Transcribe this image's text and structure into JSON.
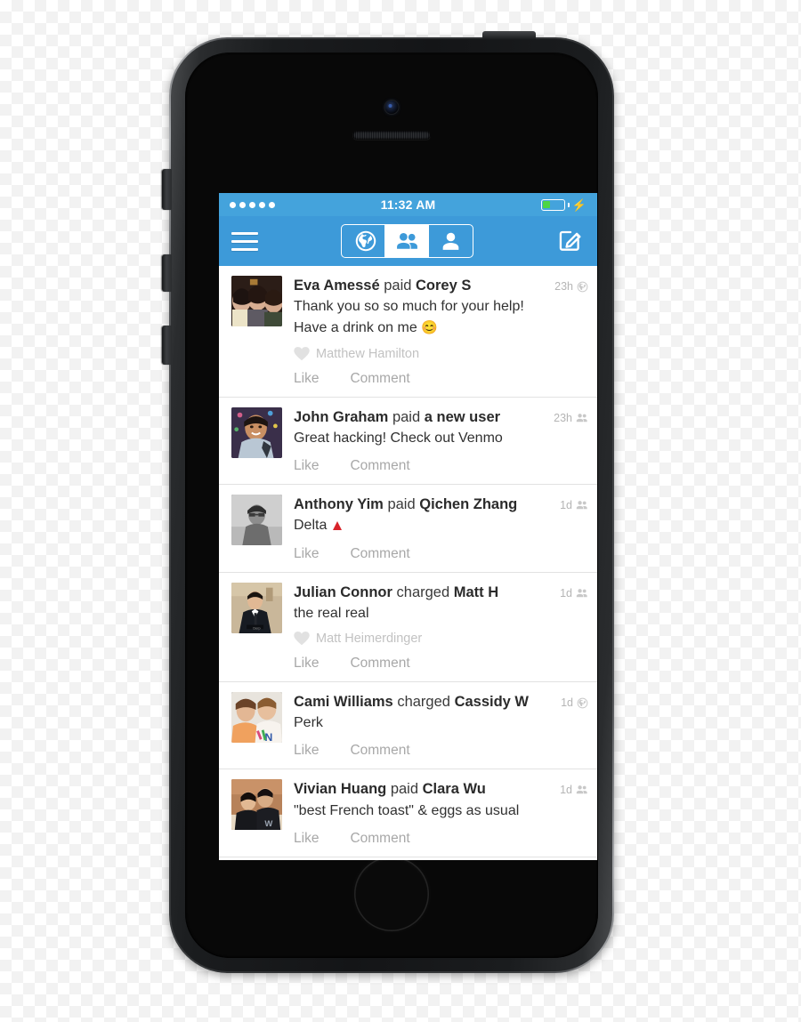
{
  "device": {
    "type": "smartphone-mockup",
    "model_style": "iphone-5s-space-gray",
    "buttons": {
      "mute_switch": "mute-switch",
      "volume_up": "volume-up-button",
      "volume_down": "volume-down-button",
      "power": "power-button",
      "home": "home-button"
    },
    "hardware_icons": {
      "camera": "front-camera",
      "speaker": "earpiece-speaker"
    }
  },
  "status_bar": {
    "signal_dots": 5,
    "time": "11:32 AM",
    "battery_percent": 35,
    "battery_color": "#4cd545",
    "charging": true,
    "charging_glyph": "⚡",
    "background": "#44a3dc"
  },
  "nav_bar": {
    "background": "#3d9ad9",
    "menu_label": "menu",
    "compose_label": "compose",
    "segments": [
      {
        "id": "public",
        "icon": "globe-icon",
        "label": "Public",
        "selected": false
      },
      {
        "id": "friends",
        "icon": "friends-icon",
        "label": "Friends",
        "selected": true
      },
      {
        "id": "mine",
        "icon": "person-icon",
        "label": "Mine",
        "selected": false
      }
    ]
  },
  "feed": {
    "actions": {
      "like": "Like",
      "comment": "Comment"
    },
    "items": [
      {
        "actor": "Eva Amessé",
        "verb": "paid",
        "target": "Corey S",
        "note": "Thank you so so much for your help!",
        "note2": "Have a drink on me",
        "emoji": "😊",
        "time": "23h",
        "audience": "globe-icon",
        "liker": "Matthew Hamilton",
        "avatar": "three-women-photo"
      },
      {
        "actor": "John Graham",
        "verb": "paid",
        "target": "a new user",
        "note": "Great hacking! Check out Venmo",
        "note2": "",
        "emoji": "",
        "time": "23h",
        "audience": "friends-icon",
        "liker": "",
        "avatar": "man-smiling-photo"
      },
      {
        "actor": "Anthony Yim",
        "verb": "paid",
        "target": "Qichen Zhang",
        "note": "Delta",
        "note2": "",
        "emoji": "",
        "time": "1d",
        "audience": "friends-icon",
        "liker": "",
        "avatar": "man-bw-photo",
        "trailing_glyph": "delta-triangle"
      },
      {
        "actor": "Julian Connor",
        "verb": "charged",
        "target": "Matt H",
        "note": "the real real",
        "note2": "",
        "emoji": "",
        "time": "1d",
        "audience": "friends-icon",
        "liker": "Matt Heimerdinger",
        "avatar": "man-suit-photo"
      },
      {
        "actor": "Cami Williams",
        "verb": "charged",
        "target": "Cassidy W",
        "note": "Perk",
        "note2": "",
        "emoji": "",
        "time": "1d",
        "audience": "globe-icon",
        "liker": "",
        "avatar": "two-women-photo"
      },
      {
        "actor": "Vivian Huang",
        "verb": "paid",
        "target": "Clara Wu",
        "note": "\"best French toast\" & eggs as usual",
        "note2": "",
        "emoji": "",
        "time": "1d",
        "audience": "friends-icon",
        "liker": "",
        "avatar": "couple-photo"
      }
    ]
  }
}
